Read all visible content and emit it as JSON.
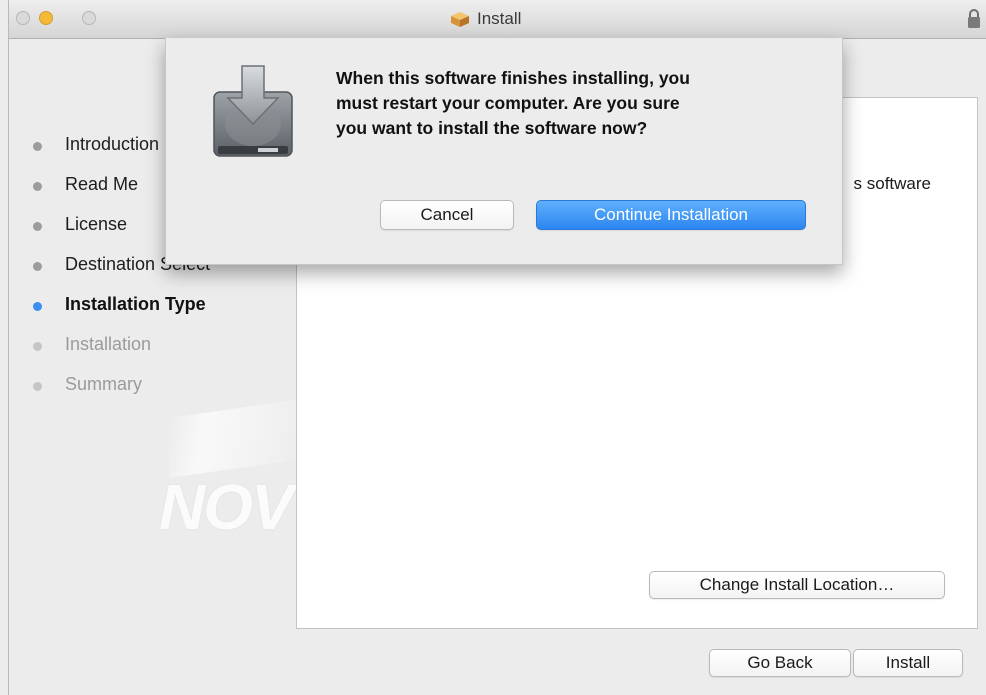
{
  "window": {
    "title": "Install"
  },
  "steps": [
    {
      "label": "Introduction",
      "state": "done"
    },
    {
      "label": "Read Me",
      "state": "done"
    },
    {
      "label": "License",
      "state": "done"
    },
    {
      "label": "Destination Select",
      "state": "done"
    },
    {
      "label": "Installation Type",
      "state": "active"
    },
    {
      "label": "Installation",
      "state": "pending"
    },
    {
      "label": "Summary",
      "state": "pending"
    }
  ],
  "panel": {
    "text_fragment": "s software"
  },
  "watermark": "NOV",
  "buttons": {
    "change_location": "Change Install Location…",
    "go_back": "Go Back",
    "install": "Install"
  },
  "dialog": {
    "message_lines": [
      "When this software finishes installing, you",
      "must restart your computer. Are you sure",
      "you want to install the software now?"
    ],
    "cancel": "Cancel",
    "continue": "Continue Installation"
  },
  "colors": {
    "accent": "#3c8ff0",
    "continue_button": "#2c86f1"
  },
  "icons": [
    "package-icon",
    "lock-icon",
    "disk-download-icon"
  ]
}
